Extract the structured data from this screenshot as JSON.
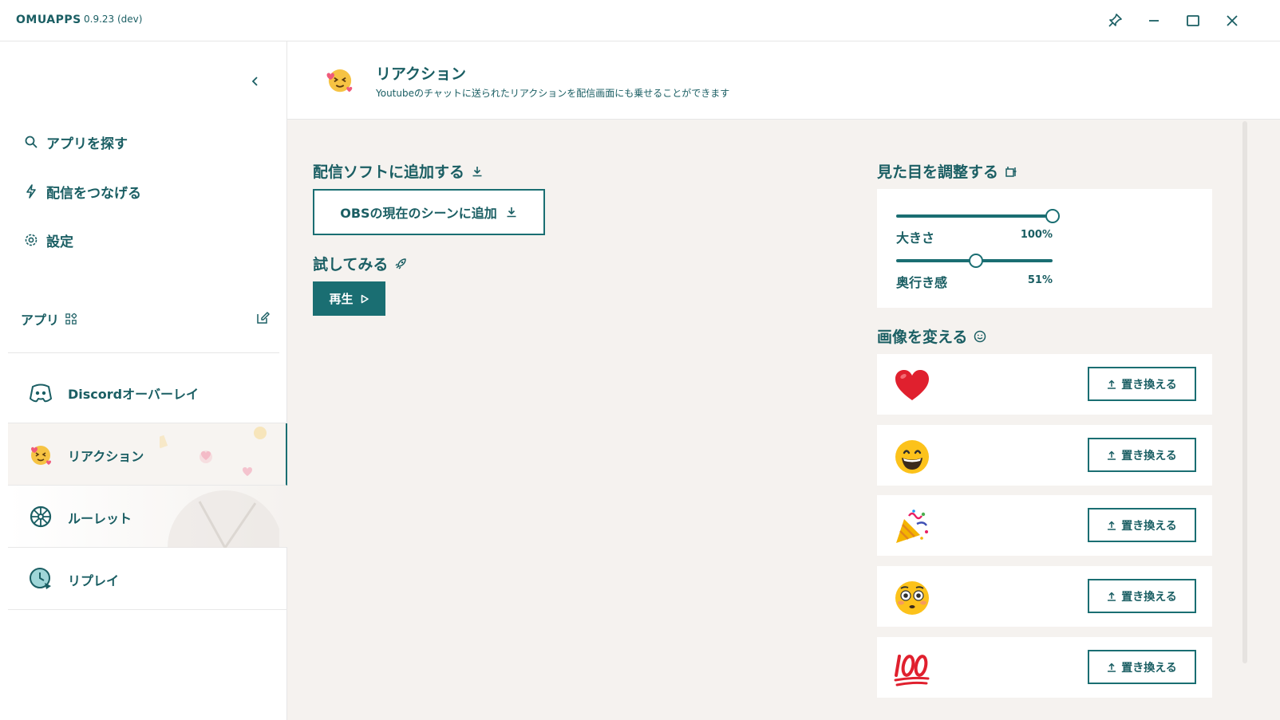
{
  "titlebar": {
    "app_name": "OMUAPPS",
    "version": "0.9.23 (dev)",
    "controls": [
      "pin-icon",
      "minimize-icon",
      "maximize-icon",
      "close-icon"
    ]
  },
  "sidebar": {
    "nav": [
      {
        "label": "アプリを探す",
        "icon": "search-icon"
      },
      {
        "label": "配信をつなげる",
        "icon": "lightning-icon"
      },
      {
        "label": "設定",
        "icon": "gear-icon"
      }
    ],
    "apps_header": "アプリ",
    "apps": [
      {
        "label": "Discordオーバーレイ",
        "icon": "discord-icon",
        "active": false
      },
      {
        "label": "リアクション",
        "icon": "reaction-emoji-icon",
        "active": true
      },
      {
        "label": "ルーレット",
        "icon": "roulette-icon",
        "active": false
      },
      {
        "label": "リプレイ",
        "icon": "replay-icon",
        "active": false
      }
    ]
  },
  "header": {
    "title": "リアクション",
    "subtitle": "Youtubeのチャットに送られたリアクションを配信画面にも乗せることができます"
  },
  "main": {
    "add_section_title": "配信ソフトに追加する",
    "obs_button": "OBSの現在のシーンに追加",
    "try_section_title": "試してみる",
    "play_button": "再生",
    "adjust_section_title": "見た目を調整する",
    "sliders": [
      {
        "label": "大きさ",
        "value": 100,
        "display": "100",
        "unit": "%"
      },
      {
        "label": "奥行き感",
        "value": 51,
        "display": "51",
        "unit": "%"
      }
    ],
    "images_section_title": "画像を変える",
    "images": [
      {
        "emoji": "heart-emoji",
        "button": "置き換える"
      },
      {
        "emoji": "grinning-face-emoji",
        "button": "置き換える"
      },
      {
        "emoji": "party-popper-emoji",
        "button": "置き換える"
      },
      {
        "emoji": "flushed-face-emoji",
        "button": "置き換える"
      },
      {
        "emoji": "hundred-points-emoji",
        "button": "置き換える"
      }
    ]
  },
  "colors": {
    "accent": "#1a6e72",
    "text": "#1a5e63",
    "background": "#f5f2ef"
  }
}
